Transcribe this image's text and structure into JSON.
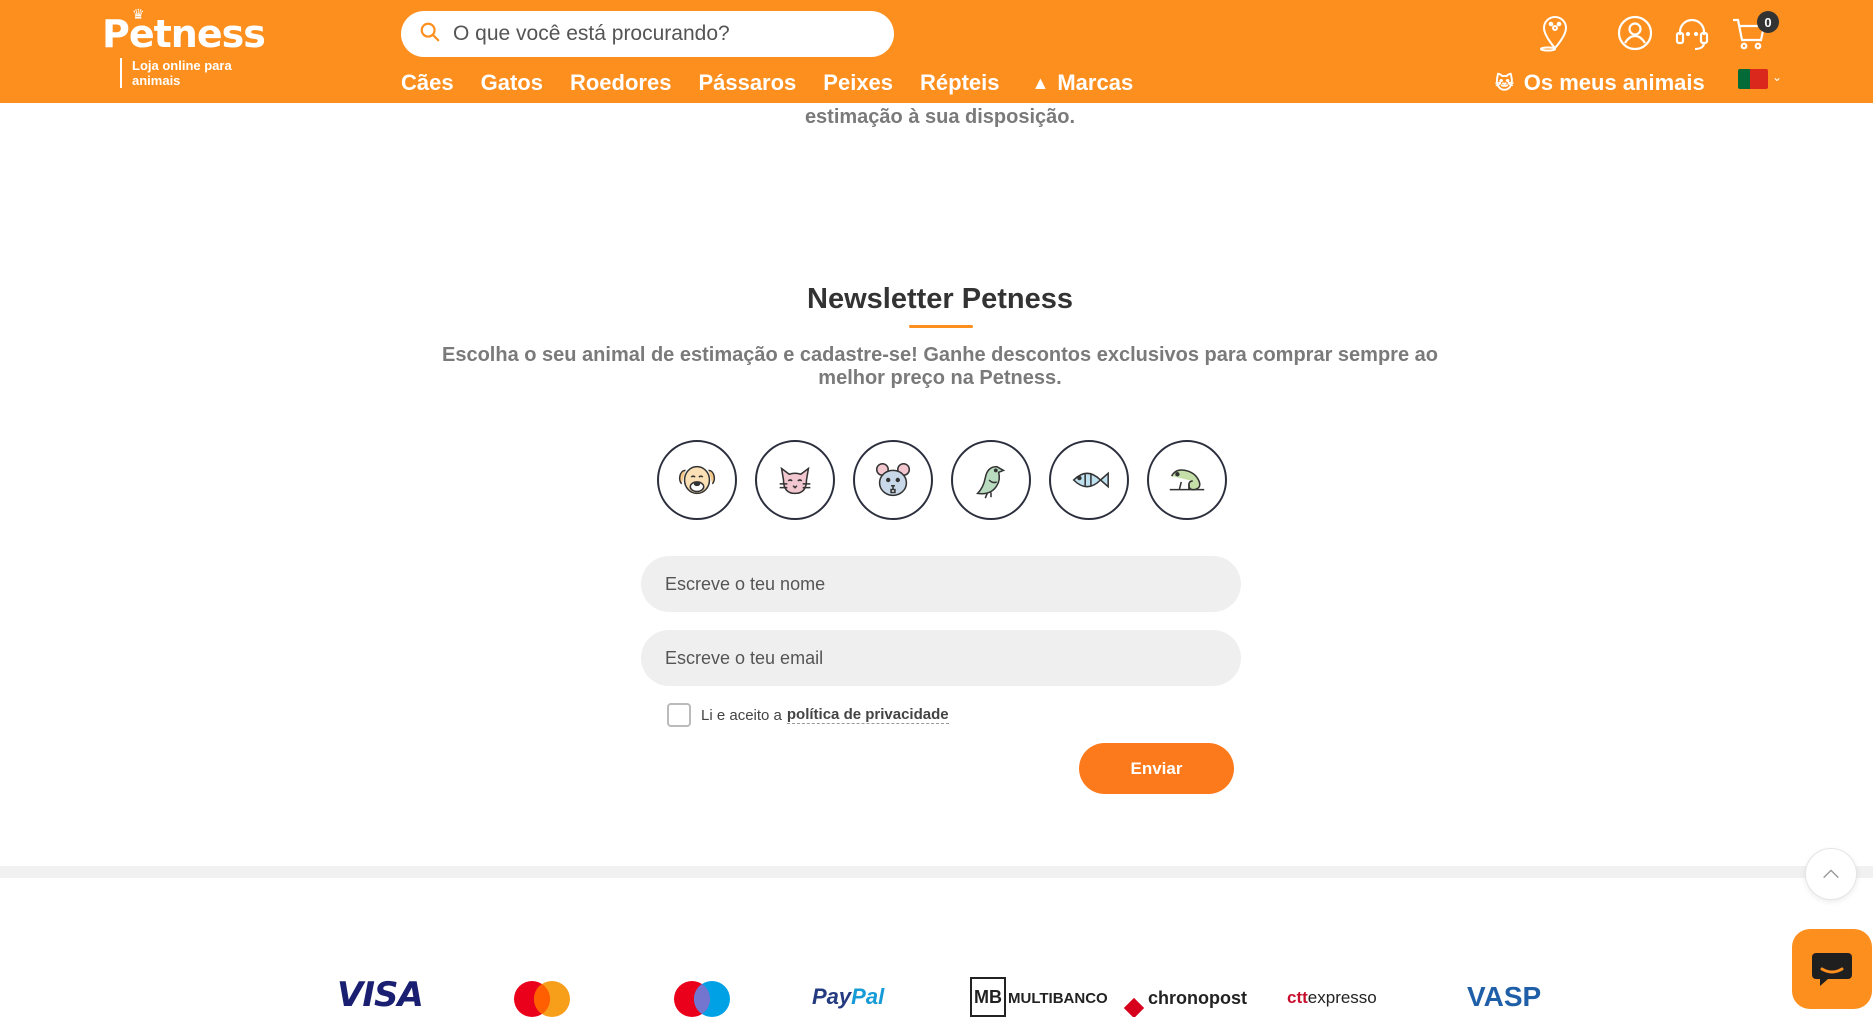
{
  "header": {
    "logo_text": "Petness",
    "logo_tagline": "Loja online para animais",
    "search_placeholder": "O que você está procurando?",
    "nav": [
      "Cães",
      "Gatos",
      "Roedores",
      "Pássaros",
      "Peixes",
      "Répteis",
      "Marcas"
    ],
    "my_pets_label": "Os meus animais",
    "cart_count": "0",
    "accent_color": "#fd8f1e"
  },
  "main": {
    "partial_text": "estimação à sua disposição.",
    "newsletter": {
      "title": "Newsletter Petness",
      "subtitle": "Escolha o seu animal de estimação e cadastre-se! Ganhe descontos exclusivos para comprar sempre ao melhor preço na Petness.",
      "pets": [
        "dog-icon",
        "cat-icon",
        "rodent-icon",
        "bird-icon",
        "fish-icon",
        "reptile-icon"
      ],
      "name_placeholder": "Escreve o teu nome",
      "email_placeholder": "Escreve o teu email",
      "consent_text": "Li e aceito a",
      "policy_link": "política de privacidade",
      "submit_label": "Enviar"
    }
  },
  "footer": {
    "logos": {
      "visa": "VISA",
      "paypal_a": "Pay",
      "paypal_b": "Pal",
      "mb_box": "MB",
      "mb_text": "MULTIBANCO",
      "chrono": "chronopost",
      "ctt_a": "ctt",
      "ctt_b": "expresso",
      "vasp": "VASP"
    }
  }
}
